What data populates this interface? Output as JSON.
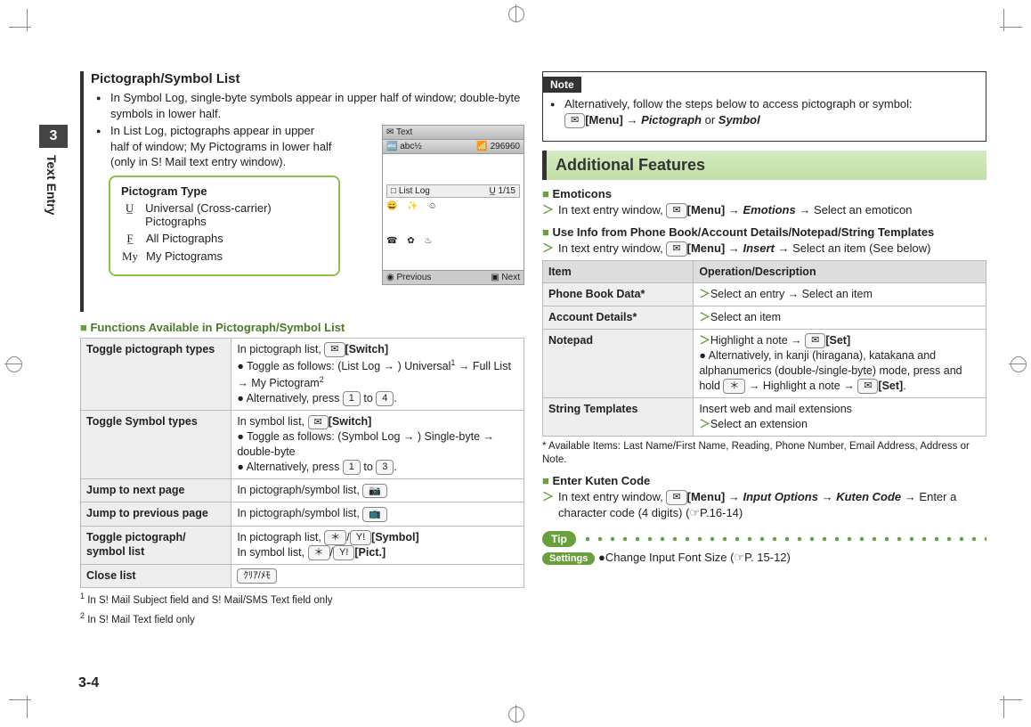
{
  "sideTab": {
    "num": "3",
    "label": "Text Entry"
  },
  "pageNum": "3-4",
  "left": {
    "title": "Pictograph/Symbol List",
    "bullets": [
      "In Symbol Log, single-byte symbols appear in upper half of window; double-byte symbols in lower half.",
      "In List Log, pictographs appear in upper half of window; My Pictograms in lower half (only in S! Mail text entry window)."
    ],
    "pictogramType": {
      "title": "Pictogram Type",
      "rows": [
        {
          "icon": "U̲",
          "text": "Universal (Cross-carrier) Pictographs"
        },
        {
          "icon": "F̲",
          "text": "All Pictographs"
        },
        {
          "icon": "My",
          "text": "My Pictograms"
        }
      ]
    },
    "phoneShot": {
      "titleBar": "✉ Text",
      "subBar1": "🔤 abc½",
      "subBar2": "📶 296960",
      "listLog": "□ List Log",
      "listLogBadge": "U̲  1/15",
      "iconsRow1": "😄 ✨ ☺",
      "iconsRow2": "☎ ✿ ♨",
      "footerL": "◉ Previous",
      "footerR": "▣ Next"
    },
    "funcHeading": "Functions Available in Pictograph/Symbol List",
    "table1": [
      {
        "item": "Toggle pictograph types",
        "desc_parts": [
          "In pictograph list, ",
          "[Switch]",
          "● Toggle as follows: (List Log → ) Universal",
          "1",
          " → Full List → My Pictogram",
          "2",
          "● Alternatively, press ",
          " to ",
          "."
        ]
      },
      {
        "item": "Toggle Symbol types",
        "desc_parts": [
          "In symbol list, ",
          "[Switch]",
          "● Toggle as follows: (Symbol Log → ) Single-byte → double-byte",
          "● Alternatively, press ",
          " to ",
          "."
        ]
      },
      {
        "item": "Jump to next page",
        "desc": "In pictograph/symbol list, "
      },
      {
        "item": "Jump to previous page",
        "desc": "In pictograph/symbol list, "
      },
      {
        "item": "Toggle pictograph/ symbol list",
        "desc_parts": [
          "In pictograph list, ",
          "/",
          "[Symbol]",
          "In symbol list, ",
          "/",
          "[Pict.]"
        ]
      },
      {
        "item": "Close list",
        "desc": ""
      }
    ],
    "footnotes": [
      "In S! Mail Subject field and S! Mail/SMS Text field only",
      "In S! Mail Text field only"
    ]
  },
  "right": {
    "note": {
      "label": "Note",
      "text1": "Alternatively, follow the steps below to access pictograph or symbol:",
      "text2a": "[Menu]",
      "text2b": "Pictograph",
      "text2c": "Symbol"
    },
    "heading": "Additional Features",
    "emoticons": {
      "title": "Emoticons",
      "step": "In text entry window, ",
      "menu": "[Menu]",
      "emotions": "Emotions",
      "tail": " → Select an emoticon"
    },
    "useInfo": {
      "title": "Use Info from Phone Book/Account Details/Notepad/String Templates",
      "step": "In text entry window, ",
      "menu": "[Menu]",
      "insert": "Insert",
      "tail": " → Select an item (See below)"
    },
    "table2": {
      "headItem": "Item",
      "headDesc": "Operation/Description",
      "rows": [
        {
          "item": "Phone Book Data*",
          "desc": "Select an entry → Select an item"
        },
        {
          "item": "Account Details*",
          "desc": "Select an item"
        },
        {
          "item": "Notepad",
          "desc1": "Highlight a note → ",
          "set": "[Set]",
          "desc2": "Alternatively, in kanji (hiragana), katakana and alphanumerics (double-/single-byte) mode, press and hold ",
          "desc3": " → Highlight a note → "
        },
        {
          "item": "String Templates",
          "desc0": "Insert web and mail extensions",
          "desc": "Select an extension"
        }
      ],
      "foot": "* Available Items: Last Name/First Name, Reading, Phone Number, Email Address, Address or Note."
    },
    "kuten": {
      "title": "Enter Kuten Code",
      "step": "In text entry window, ",
      "menu": "[Menu]",
      "opt": "Input Options",
      "code": "Kuten Code",
      "tail": "Enter a character code (4 digits) (☞P.16-14)"
    },
    "tip": {
      "label": "Tip"
    },
    "settings": {
      "label": "Settings",
      "text": "●Change Input Font Size (☞P. 15-12)"
    }
  }
}
